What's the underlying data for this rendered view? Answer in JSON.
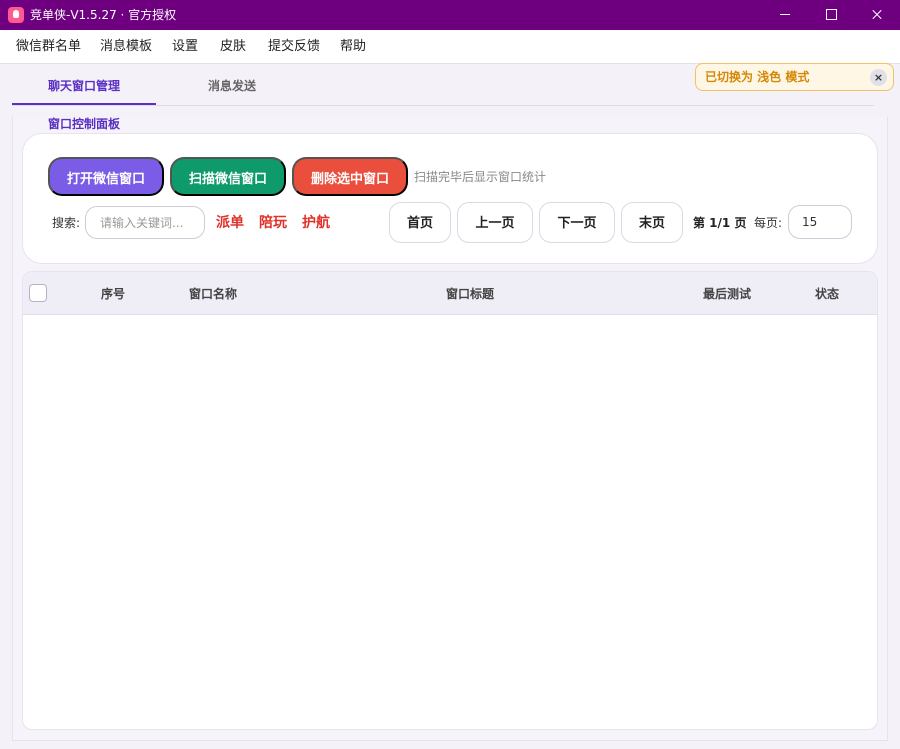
{
  "window": {
    "title": "竞单侠-V1.5.27 · 官方授权"
  },
  "menu": {
    "items": [
      "微信群名单",
      "消息模板",
      "设置",
      "皮肤",
      "提交反馈",
      "帮助"
    ]
  },
  "tabs": {
    "active": "聊天窗口管理",
    "inactive": "消息发送"
  },
  "toast": {
    "message": "已切换为 浅色 模式",
    "close_symbol": "×",
    "accent_color": "#d48806"
  },
  "panel": {
    "label": "窗口控制面板"
  },
  "actions": {
    "open_label": "打开微信窗口",
    "scan_label": "扫描微信窗口",
    "delete_label": "删除选中窗口",
    "scan_hint": "扫描完毕后显示窗口统计",
    "colors": {
      "open": "#7b5ce6",
      "scan": "#0f9a6c",
      "delete": "#ea4e3d"
    }
  },
  "search": {
    "label": "搜索:",
    "placeholder": "请输入关键词...",
    "value": ""
  },
  "tags": [
    "派单",
    "陪玩",
    "护航"
  ],
  "pagination": {
    "first": "首页",
    "prev": "上一页",
    "next": "下一页",
    "last": "末页",
    "info": "第 1/1 页",
    "per_page_label": "每页:",
    "per_page_value": "15"
  },
  "table": {
    "columns": [
      "序号",
      "窗口名称",
      "窗口标题",
      "最后测试",
      "状态"
    ],
    "rows": []
  },
  "theme": {
    "title_bar": "#6e0080",
    "accent": "#5a2fc2"
  }
}
